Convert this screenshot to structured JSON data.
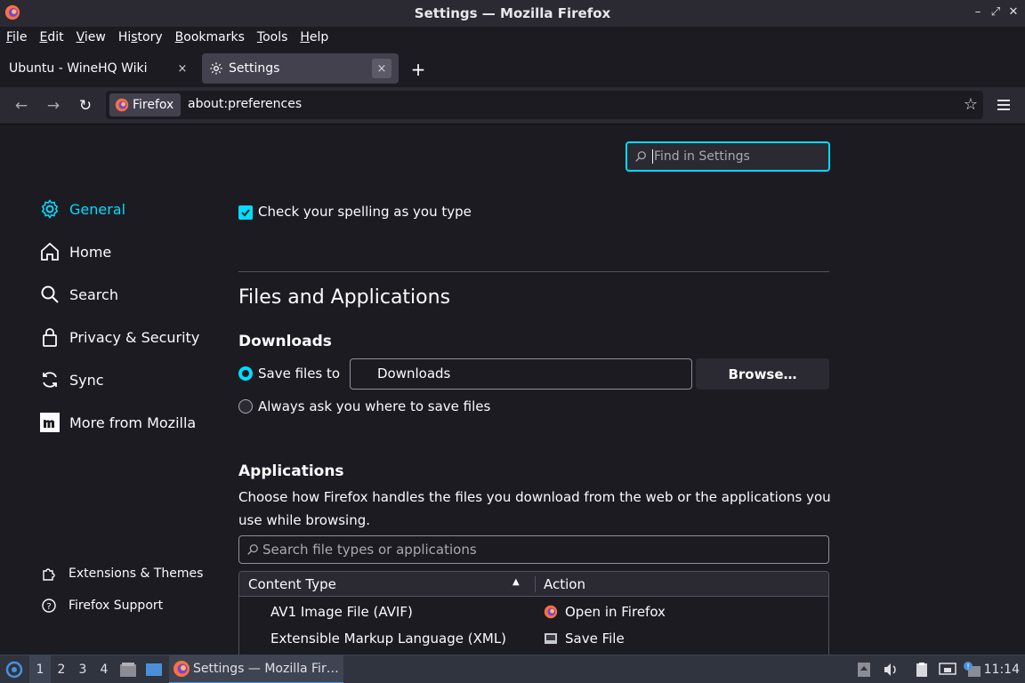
{
  "window": {
    "title": "Settings — Mozilla Firefox"
  },
  "menubar": {
    "items": [
      {
        "pre": "",
        "ul": "F",
        "post": "ile"
      },
      {
        "pre": "",
        "ul": "E",
        "post": "dit"
      },
      {
        "pre": "",
        "ul": "V",
        "post": "iew"
      },
      {
        "pre": "Hi",
        "ul": "s",
        "post": "tory"
      },
      {
        "pre": "",
        "ul": "B",
        "post": "ookmarks"
      },
      {
        "pre": "",
        "ul": "T",
        "post": "ools"
      },
      {
        "pre": "",
        "ul": "H",
        "post": "elp"
      }
    ]
  },
  "tabs": [
    {
      "label": "Ubuntu - WineHQ Wiki",
      "close": "×"
    },
    {
      "label": "Settings",
      "close": "×"
    }
  ],
  "newtab": "+",
  "navbar": {
    "identity_label": "Firefox",
    "url": "about:preferences"
  },
  "search": {
    "placeholder": "Find in Settings"
  },
  "sidebar": {
    "items": [
      {
        "label": "General",
        "icon": "gear-icon"
      },
      {
        "label": "Home",
        "icon": "home-icon"
      },
      {
        "label": "Search",
        "icon": "search-icon"
      },
      {
        "label": "Privacy & Security",
        "icon": "lock-icon"
      },
      {
        "label": "Sync",
        "icon": "sync-icon"
      },
      {
        "label": "More from Mozilla",
        "icon": "mozilla-icon"
      }
    ],
    "footer": [
      {
        "label": "Extensions & Themes",
        "icon": "puzzle-icon"
      },
      {
        "label": "Firefox Support",
        "icon": "help-icon"
      }
    ]
  },
  "main": {
    "spellcheck_label": "Check your spelling as you type",
    "section_title": "Files and Applications",
    "downloads": {
      "heading": "Downloads",
      "save_files_label": "Save files to",
      "folder": "Downloads",
      "browse_label": "Browse…",
      "always_ask_label": "Always ask you where to save files"
    },
    "applications": {
      "heading": "Applications",
      "description": "Choose how Firefox handles the files you download from the web or the applications you use while browsing.",
      "search_placeholder": "Search file types or applications",
      "columns": [
        "Content Type",
        "Action"
      ],
      "rows": [
        {
          "type": "AV1 Image File (AVIF)",
          "action": "Open in Firefox",
          "action_icon": "firefox-icon"
        },
        {
          "type": "Extensible Markup Language (XML)",
          "action": "Save File",
          "action_icon": "save-icon"
        }
      ]
    }
  },
  "taskbar": {
    "workspaces": [
      "1",
      "2",
      "3",
      "4"
    ],
    "task_label": "Settings — Mozilla Fir…",
    "clock": "11:14"
  },
  "colors": {
    "accent": "#00ddff",
    "background": "#1c1b22",
    "surface": "#2b2a33"
  }
}
